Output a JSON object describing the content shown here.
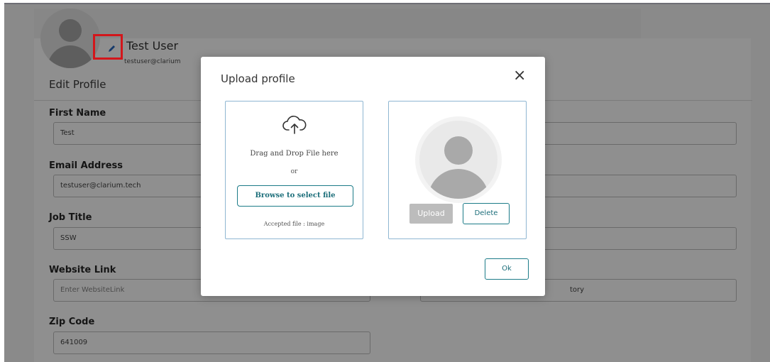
{
  "profile": {
    "name": "Test User",
    "email": "testuser@clarium",
    "edit_title": "Edit Profile"
  },
  "form": {
    "first_name": {
      "label": "First Name",
      "value": "Test"
    },
    "email": {
      "label": "Email Address",
      "value": "testuser@clarium.tech"
    },
    "job_title": {
      "label": "Job Title",
      "value": "SSW"
    },
    "website": {
      "label": "Website Link",
      "placeholder": "Enter WebsiteLink"
    },
    "zip": {
      "label": "Zip Code",
      "value": "641009"
    },
    "right_field_fragment": "tory"
  },
  "modal": {
    "title": "Upload profile",
    "close": "×",
    "drop_text": "Drag and Drop File here",
    "or_text": "or",
    "browse_label": "Browse to select file",
    "accepted_text": "Accepted file : image",
    "upload_label": "Upload",
    "delete_label": "Delete",
    "ok_label": "Ok"
  },
  "colors": {
    "accent": "#1c7b88",
    "dropzone_border": "#8fb6d2",
    "highlight": "#d3161b",
    "overlay": "#8a8a8a"
  },
  "icons": {
    "edit": "pencil-icon",
    "cloud": "cloud-upload-icon",
    "close": "close-icon",
    "avatar": "user-avatar-icon"
  }
}
